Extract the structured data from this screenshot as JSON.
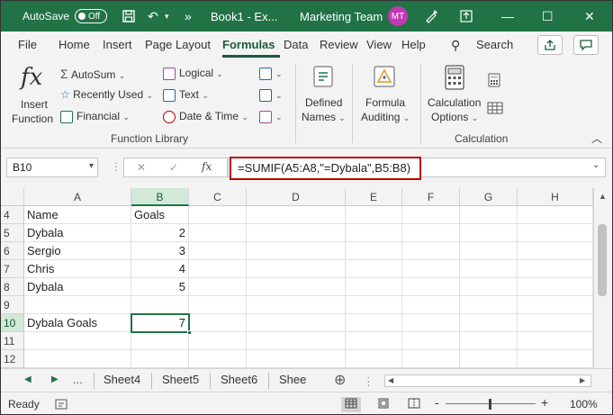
{
  "titlebar": {
    "autosave_label": "AutoSave",
    "autosave_state": "Off",
    "filename": "Book1 - Ex...",
    "account": "Marketing Team",
    "avatar_initials": "MT",
    "overflow_label": "»",
    "accent": "#217346"
  },
  "menu": {
    "tabs": [
      "File",
      "Home",
      "Insert",
      "Page Layout",
      "Formulas",
      "Data",
      "Review",
      "View",
      "Help"
    ],
    "active": "Formulas",
    "search_label": "Search"
  },
  "ribbon": {
    "insert_function_line1": "Insert",
    "insert_function_line2": "Function",
    "fx_glyph": "fx",
    "autosum": "AutoSum",
    "recently_used": "Recently Used",
    "financial": "Financial",
    "logical": "Logical",
    "text": "Text",
    "date_time": "Date & Time",
    "defined_names_line1": "Defined",
    "defined_names_line2": "Names",
    "formula_auditing_line1": "Formula",
    "formula_auditing_line2": "Auditing",
    "calculation_options_line1": "Calculation",
    "calculation_options_line2": "Options",
    "group_function_library": "Function Library",
    "group_calculation": "Calculation"
  },
  "formula_bar": {
    "name_box": "B10",
    "cancel_glyph": "✕",
    "enter_glyph": "✓",
    "fx_glyph": "fx",
    "formula": "=SUMIF(A5:A8,\"=Dybala\",B5:B8)"
  },
  "grid": {
    "columns": [
      "A",
      "B",
      "C",
      "D",
      "E",
      "F",
      "G",
      "H"
    ],
    "rows": [
      {
        "num": "4",
        "a": "Name",
        "b": "Goals"
      },
      {
        "num": "5",
        "a": "Dybala",
        "b": "2"
      },
      {
        "num": "6",
        "a": "Sergio",
        "b": "3"
      },
      {
        "num": "7",
        "a": "Chris",
        "b": "4"
      },
      {
        "num": "8",
        "a": "Dybala",
        "b": "5"
      },
      {
        "num": "9",
        "a": "",
        "b": ""
      },
      {
        "num": "10",
        "a": "Dybala Goals",
        "b": "7"
      },
      {
        "num": "11",
        "a": "",
        "b": ""
      },
      {
        "num": "12",
        "a": "",
        "b": ""
      }
    ]
  },
  "sheets": {
    "ellipsis": "...",
    "tabs": [
      "Sheet4",
      "Sheet5",
      "Sheet6",
      "Shee"
    ]
  },
  "status": {
    "ready": "Ready",
    "zoom_minus": "-",
    "zoom_plus": "+",
    "zoom": "100%"
  }
}
